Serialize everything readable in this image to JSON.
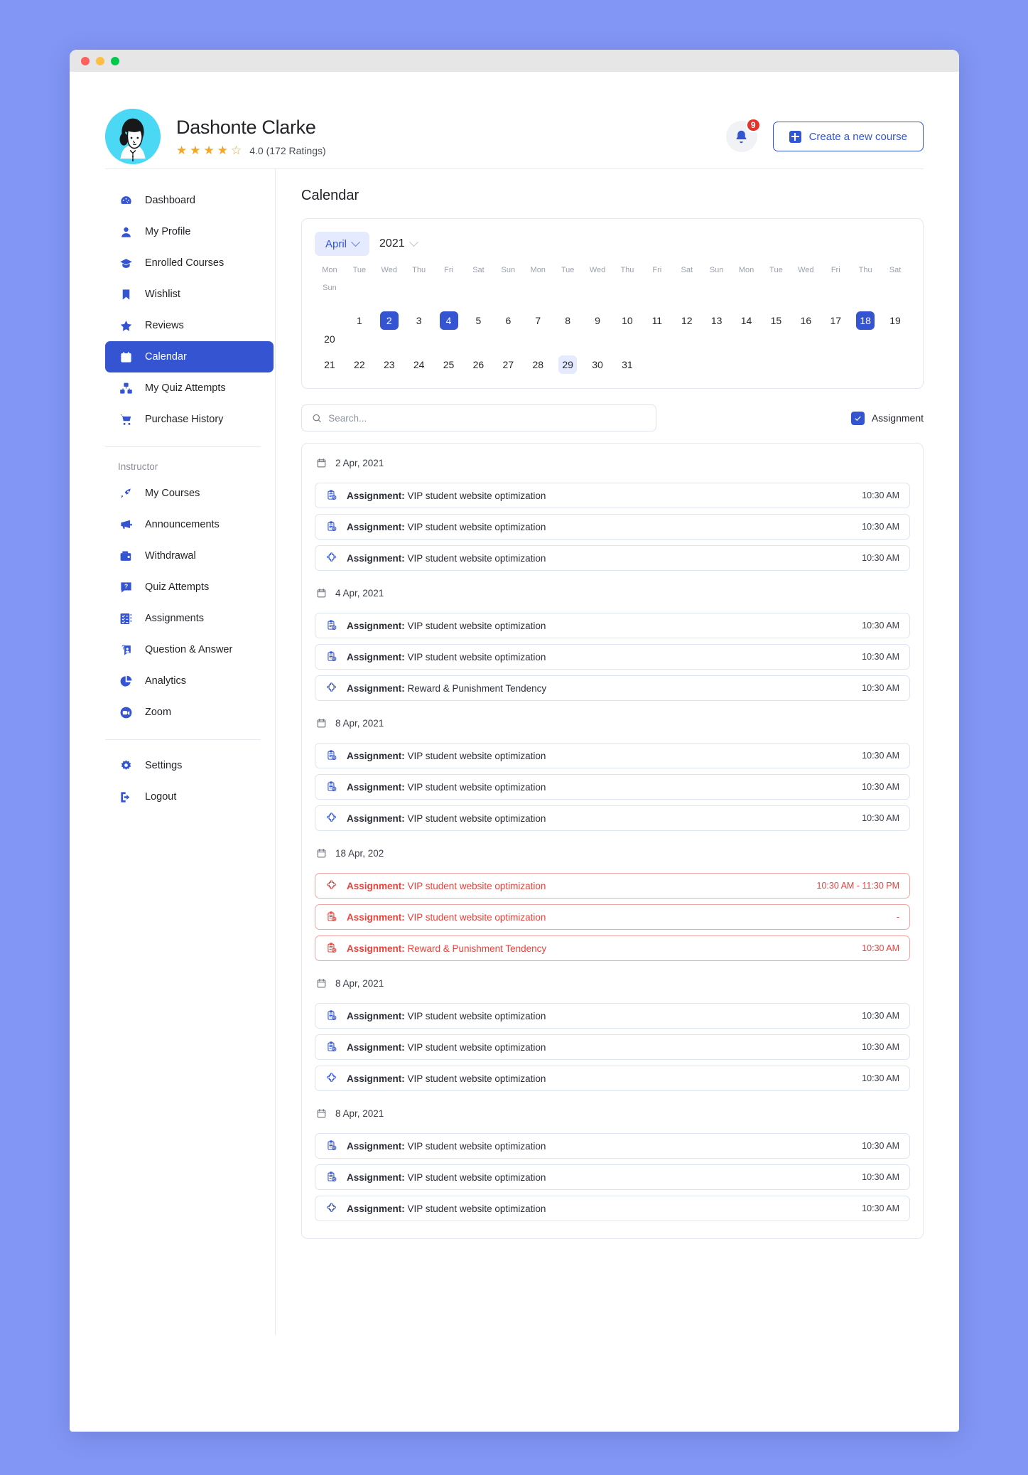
{
  "window": {
    "dots": [
      "close",
      "minimize",
      "maximize"
    ]
  },
  "header": {
    "user_name": "Dashonte Clarke",
    "rating_value": "4.0",
    "rating_text": "4.0 (172 Ratings)",
    "stars_filled": 4,
    "stars_total": 5,
    "notification_count": "9",
    "create_button": "Create a new course"
  },
  "sidebar": {
    "primary": [
      {
        "label": "Dashboard",
        "icon": "dashboard-icon",
        "active": false
      },
      {
        "label": "My Profile",
        "icon": "user-icon",
        "active": false
      },
      {
        "label": "Enrolled Courses",
        "icon": "graduation-cap-icon",
        "active": false
      },
      {
        "label": "Wishlist",
        "icon": "bookmark-icon",
        "active": false
      },
      {
        "label": "Reviews",
        "icon": "star-icon",
        "active": false
      },
      {
        "label": "Calendar",
        "icon": "calendar-icon",
        "active": true
      },
      {
        "label": "My Quiz Attempts",
        "icon": "quiz-blocks-icon",
        "active": false
      },
      {
        "label": "Purchase History",
        "icon": "cart-icon",
        "active": false
      }
    ],
    "group_label": "Instructor",
    "instructor": [
      {
        "label": "My Courses",
        "icon": "rocket-icon"
      },
      {
        "label": "Announcements",
        "icon": "megaphone-icon"
      },
      {
        "label": "Withdrawal",
        "icon": "wallet-icon"
      },
      {
        "label": "Quiz Attempts",
        "icon": "question-box-icon"
      },
      {
        "label": "Assignments",
        "icon": "checklist-icon"
      },
      {
        "label": "Question & Answer",
        "icon": "qa-icon"
      },
      {
        "label": "Analytics",
        "icon": "pie-chart-icon"
      },
      {
        "label": "Zoom",
        "icon": "video-camera-icon"
      }
    ],
    "footer": [
      {
        "label": "Settings",
        "icon": "gear-icon"
      },
      {
        "label": "Logout",
        "icon": "logout-icon"
      }
    ]
  },
  "main": {
    "page_title": "Calendar",
    "calendar": {
      "month": "April",
      "year": "2021",
      "dow": [
        "Mon",
        "Tue",
        "Wed",
        "Thu",
        "Fri",
        "Sat",
        "Sun",
        "Mon",
        "Tue",
        "Wed",
        "Thu",
        "Fri",
        "Sat",
        "Sun",
        "Mon",
        "Tue",
        "Wed",
        "Fri",
        "Thu",
        "Sat",
        "Sun"
      ],
      "week_row": [
        {
          "dow": "Mon",
          "day": ""
        },
        {
          "dow": "Tue",
          "day": "1"
        },
        {
          "dow": "Wed",
          "day": "2",
          "state": "selected"
        },
        {
          "dow": "Thu",
          "day": "3"
        },
        {
          "dow": "Fri",
          "day": "4",
          "state": "selected"
        },
        {
          "dow": "Sat",
          "day": "5"
        },
        {
          "dow": "Sun",
          "day": "6"
        },
        {
          "dow": "Mon",
          "day": "7"
        },
        {
          "dow": "Tue",
          "day": "8"
        },
        {
          "dow": "Wed",
          "day": "9"
        },
        {
          "dow": "Thu",
          "day": "10"
        },
        {
          "dow": "Fri",
          "day": "11"
        },
        {
          "dow": "Sat",
          "day": "12"
        },
        {
          "dow": "Sun",
          "day": "13"
        },
        {
          "dow": "Mon",
          "day": "14"
        },
        {
          "dow": "Tue",
          "day": "15"
        },
        {
          "dow": "Wed",
          "day": "16"
        },
        {
          "dow": "Fri",
          "day": "17"
        },
        {
          "dow": "Thu",
          "day": "18",
          "state": "selected"
        },
        {
          "dow": "Sat",
          "day": "19"
        },
        {
          "dow": "Sun",
          "day": "20"
        }
      ],
      "second_row": [
        {
          "day": "21"
        },
        {
          "day": "22"
        },
        {
          "day": "23"
        },
        {
          "day": "24"
        },
        {
          "day": "25"
        },
        {
          "day": "26"
        },
        {
          "day": "27"
        },
        {
          "day": "28"
        },
        {
          "day": "29",
          "state": "soft"
        },
        {
          "day": "30"
        },
        {
          "day": "31"
        }
      ]
    },
    "search": {
      "placeholder": "Search...",
      "value": ""
    },
    "filter": {
      "assignment_label": "Assignment",
      "assignment_checked": true
    },
    "groups": [
      {
        "date": "2 Apr, 2021",
        "events": [
          {
            "prefix": "Assignment:",
            "title": " VIP student website optimization",
            "time": "10:30 AM",
            "icon": "clipboard-clock-icon",
            "alert": false
          },
          {
            "prefix": "Assignment:",
            "title": " VIP student website optimization",
            "time": "10:30 AM",
            "icon": "clipboard-clock-icon",
            "alert": false
          },
          {
            "prefix": "Assignment:",
            "title": " VIP student website optimization",
            "time": "10:30 AM",
            "icon": "puzzle-icon",
            "alert": false
          }
        ]
      },
      {
        "date": "4 Apr, 2021",
        "events": [
          {
            "prefix": "Assignment:",
            "title": " VIP student website optimization",
            "time": "10:30 AM",
            "icon": "clipboard-clock-icon",
            "alert": false
          },
          {
            "prefix": "Assignment:",
            "title": " VIP student website optimization",
            "time": "10:30 AM",
            "icon": "clipboard-clock-icon",
            "alert": false
          },
          {
            "prefix": "Assignment:",
            "title": " Reward & Punishment Tendency",
            "time": "10:30 AM",
            "icon": "puzzle-icon",
            "alert": false
          }
        ]
      },
      {
        "date": "8 Apr, 2021",
        "events": [
          {
            "prefix": "Assignment:",
            "title": " VIP student website optimization",
            "time": "10:30 AM",
            "icon": "clipboard-clock-icon",
            "alert": false
          },
          {
            "prefix": "Assignment:",
            "title": " VIP student website optimization",
            "time": "10:30 AM",
            "icon": "clipboard-clock-icon",
            "alert": false
          },
          {
            "prefix": "Assignment:",
            "title": " VIP student website optimization",
            "time": "10:30 AM",
            "icon": "puzzle-icon",
            "alert": false
          }
        ]
      },
      {
        "date": "18 Apr, 202",
        "events": [
          {
            "prefix": "Assignment:",
            "title": " VIP student website optimization",
            "time": "10:30 AM - 11:30 PM",
            "icon": "puzzle-icon",
            "alert": true
          },
          {
            "prefix": "Assignment:",
            "title": " VIP student website optimization",
            "time": "-",
            "icon": "clipboard-clock-icon",
            "alert": true
          },
          {
            "prefix": "Assignment:",
            "title": " Reward & Punishment Tendency",
            "time": "10:30 AM",
            "icon": "clipboard-clock-icon",
            "alert": true
          }
        ]
      },
      {
        "date": "8 Apr, 2021",
        "events": [
          {
            "prefix": "Assignment:",
            "title": " VIP student website optimization",
            "time": "10:30 AM",
            "icon": "clipboard-clock-icon",
            "alert": false
          },
          {
            "prefix": "Assignment:",
            "title": " VIP student website optimization",
            "time": "10:30 AM",
            "icon": "clipboard-clock-icon",
            "alert": false
          },
          {
            "prefix": "Assignment:",
            "title": " VIP student website optimization",
            "time": "10:30 AM",
            "icon": "puzzle-icon",
            "alert": false
          }
        ]
      },
      {
        "date": "8 Apr, 2021",
        "events": [
          {
            "prefix": "Assignment:",
            "title": " VIP student website optimization",
            "time": "10:30 AM",
            "icon": "clipboard-clock-icon",
            "alert": false
          },
          {
            "prefix": "Assignment:",
            "title": " VIP student website optimization",
            "time": "10:30 AM",
            "icon": "clipboard-clock-icon",
            "alert": false
          },
          {
            "prefix": "Assignment:",
            "title": " VIP student website optimization",
            "time": "10:30 AM",
            "icon": "puzzle-icon",
            "alert": false
          }
        ]
      }
    ]
  },
  "colors": {
    "accent": "#3554d1",
    "accent_soft": "#e5eaff",
    "alert": "#e8423c",
    "page_bg": "#8296f5",
    "star": "#f5a623",
    "avatar_bg": "#4ad8f5"
  }
}
